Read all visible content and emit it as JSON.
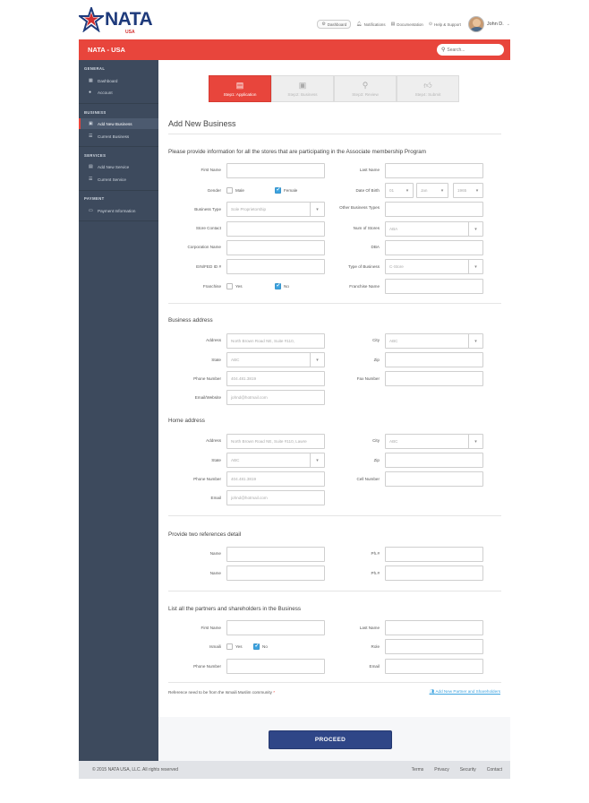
{
  "brand": {
    "name": "NATA",
    "sub": "USA"
  },
  "top_links": {
    "dashboard": "Dashboard",
    "notifications": "Notifications",
    "documentation": "Documentation",
    "help": "Help & Support"
  },
  "user": {
    "name": "John D."
  },
  "header": {
    "title": "NATA - USA",
    "search_placeholder": "Search..."
  },
  "sidebar": {
    "general": "GENERAL",
    "dashboard": "Dashboard",
    "account": "Account",
    "business": "BUSINESS",
    "add_new_business": "Add New Business",
    "current_business": "Current Business",
    "services": "SERVICES",
    "add_new_service": "Add New Service",
    "current_service": "Current Service",
    "payment": "PAYMENT",
    "payment_information": "Payment Information"
  },
  "steps": [
    {
      "label": "Step1: Application",
      "icon": "document-icon"
    },
    {
      "label": "Step2: Business",
      "icon": "briefcase-icon"
    },
    {
      "label": "Step3: Review",
      "icon": "magnifier-icon"
    },
    {
      "label": "Step4: Submit",
      "icon": "thumbs-up-icon"
    }
  ],
  "page_title": "Add New Business",
  "intro": "Please provide information for all the stores that are participating in the Associate membership Program",
  "labels": {
    "first_name": "First Name",
    "last_name": "Last Name",
    "gender": "Gender",
    "male": "Male",
    "female": "Female",
    "date_of_birth": "Date Of Birth",
    "business_type": "Business Type",
    "other_business_types": "Other Business Types",
    "store_contact": "Store Contact",
    "num_of_stores": "Num of Stores",
    "corporation_name": "Corporation Name",
    "dba": "DBA",
    "ein": "EIN/FED ID #",
    "type_of_business": "Type of Business",
    "franchise": "Franchise",
    "yes": "Yes",
    "no": "No",
    "franchise_name": "Franchise Name",
    "address": "Address",
    "city": "City",
    "state": "State",
    "zip": "Zip",
    "phone_number": "Phone Number",
    "fax_number": "Fax Number",
    "email_website": "Email/Website",
    "cell_number": "Cell  Number",
    "email": "Email",
    "name": "Name",
    "ph": "Ph.#",
    "ismaili": "Ismaili",
    "role": "Role"
  },
  "values": {
    "dob_day": "01",
    "dob_month": "Jan",
    "dob_year": "1965",
    "business_type": "Sole Proprietorship",
    "num_of_stores": "ABA",
    "type_of_business": "C-Store",
    "business_address": "North Brown Road NE, Suite #110,",
    "business_city": "ABC",
    "business_state": "ABC",
    "business_phone": "404.481.3819",
    "business_email": "johnd@hotmail.com",
    "home_address": "North Brown Road NE, Suite #110, Lawre",
    "home_city": "ABC",
    "home_state": "ABC",
    "home_phone": "404.481.3819",
    "home_email": "johnd@hotmail.com"
  },
  "sections": {
    "business_address": "Business address",
    "home_address": "Home address",
    "references": "Provide two references detail",
    "partners": "List all the partners and shareholders in the Business"
  },
  "note": "Reference need to be from the Ismaili Muslim community",
  "note_req": "*",
  "add_partner": "Add New Partner and Shareholders",
  "proceed": "PROCEED",
  "footer": {
    "copyright": "© 2015 NATA USA, LLC. All rights reserved",
    "terms": "Terms",
    "privacy": "Privacy",
    "security": "Security",
    "contact": "Contact"
  }
}
